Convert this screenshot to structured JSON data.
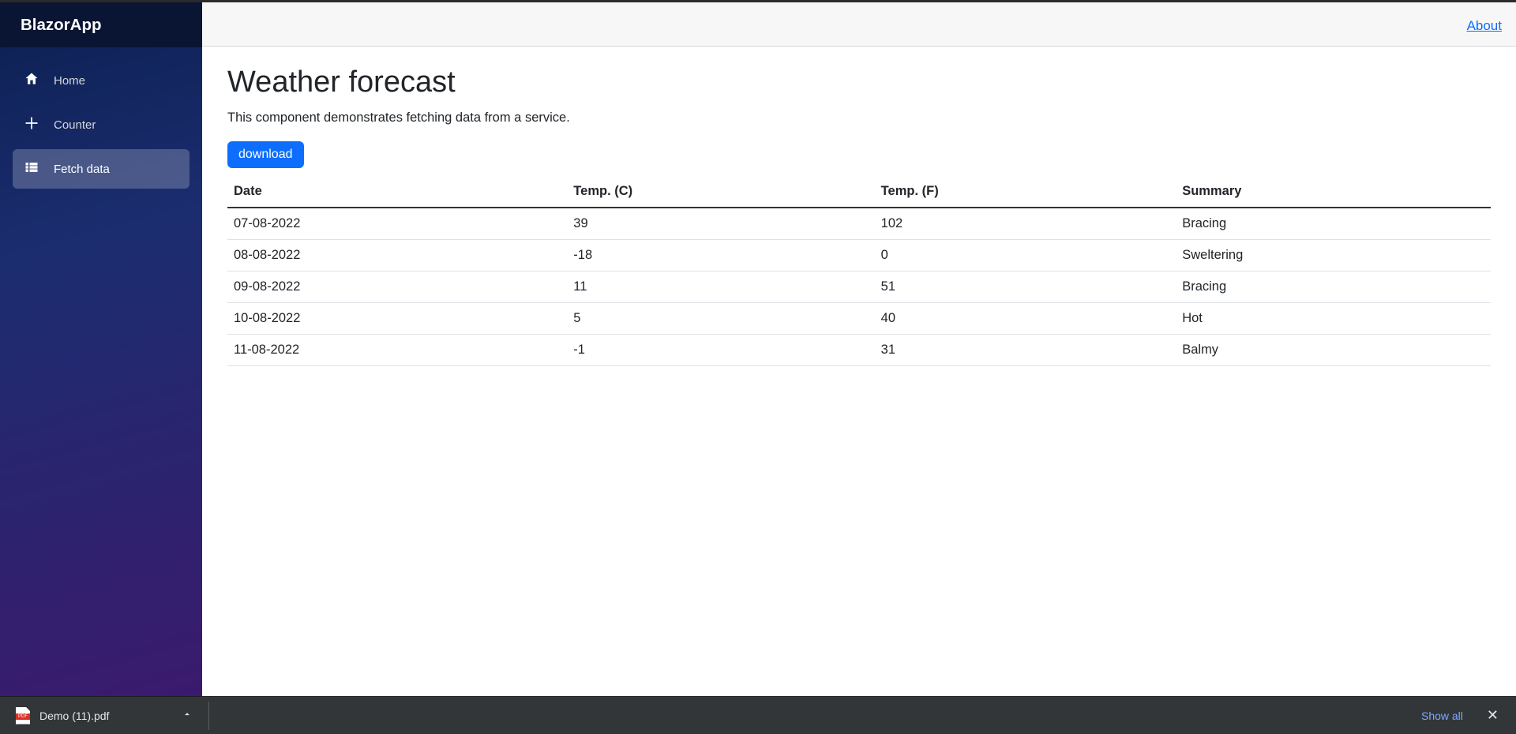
{
  "app_title": "BlazorApp",
  "topbar": {
    "about_label": "About"
  },
  "sidebar": {
    "items": [
      {
        "label": "Home"
      },
      {
        "label": "Counter"
      },
      {
        "label": "Fetch data"
      }
    ]
  },
  "page": {
    "heading": "Weather forecast",
    "description": "This component demonstrates fetching data from a service.",
    "download_button": "download"
  },
  "table": {
    "headers": {
      "date": "Date",
      "tc": "Temp. (C)",
      "tf": "Temp. (F)",
      "summary": "Summary"
    },
    "rows": [
      {
        "date": "07-08-2022",
        "tc": "39",
        "tf": "102",
        "summary": "Bracing"
      },
      {
        "date": "08-08-2022",
        "tc": "-18",
        "tf": "0",
        "summary": "Sweltering"
      },
      {
        "date": "09-08-2022",
        "tc": "11",
        "tf": "51",
        "summary": "Bracing"
      },
      {
        "date": "10-08-2022",
        "tc": "5",
        "tf": "40",
        "summary": "Hot"
      },
      {
        "date": "11-08-2022",
        "tc": "-1",
        "tf": "31",
        "summary": "Balmy"
      }
    ]
  },
  "download_bar": {
    "file_name": "Demo (11).pdf",
    "show_all": "Show all"
  }
}
